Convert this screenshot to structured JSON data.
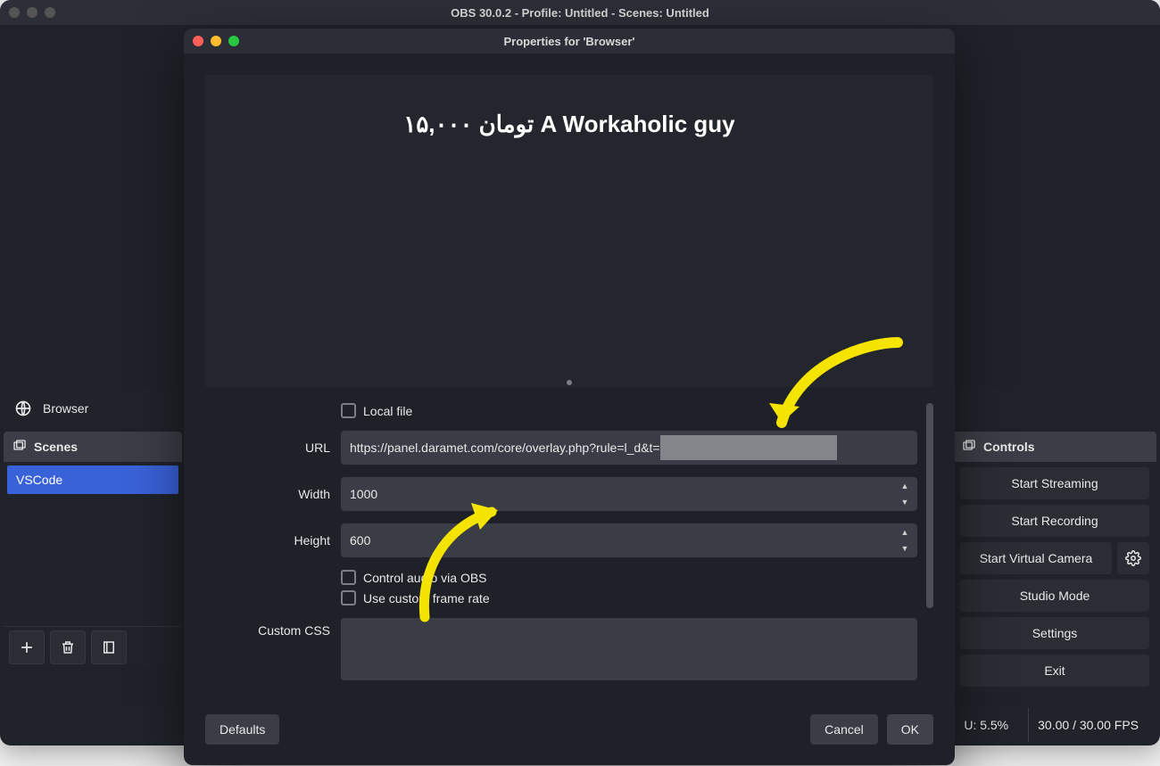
{
  "main_window": {
    "title": "OBS 30.0.2 - Profile: Untitled - Scenes: Untitled",
    "source_row": {
      "label": "Browser"
    },
    "scenes_panel": {
      "header": "Scenes",
      "items": [
        {
          "label": "VSCode"
        }
      ]
    },
    "scenes_toolbar": {
      "add": "+",
      "remove": "trash",
      "filter": "filter"
    },
    "controls_panel": {
      "header": "Controls",
      "start_streaming": "Start Streaming",
      "start_recording": "Start Recording",
      "start_virtual_camera": "Start Virtual Camera",
      "studio_mode": "Studio Mode",
      "settings": "Settings",
      "exit": "Exit"
    },
    "statusbar": {
      "cpu": "U: 5.5%",
      "fps": "30.00 / 30.00 FPS"
    }
  },
  "dialog": {
    "title": "Properties for 'Browser'",
    "preview_text": "۱۵,۰۰۰ تومان A Workaholic guy",
    "local_file_label": "Local file",
    "url_label": "URL",
    "url_value": "https://panel.daramet.com/core/overlay.php?rule=l_d&t=",
    "width_label": "Width",
    "width_value": "1000",
    "height_label": "Height",
    "height_value": "600",
    "control_audio_label": "Control audio via OBS",
    "custom_framerate_label": "Use custom frame rate",
    "custom_css_label": "Custom CSS",
    "defaults_btn": "Defaults",
    "cancel_btn": "Cancel",
    "ok_btn": "OK"
  }
}
